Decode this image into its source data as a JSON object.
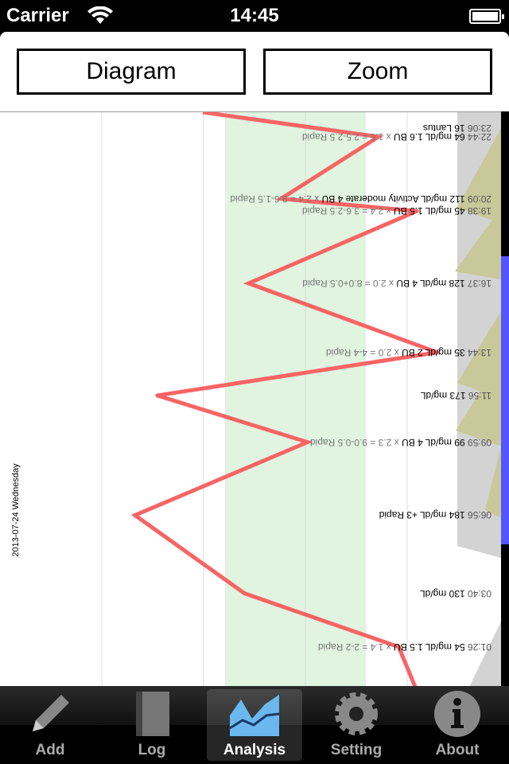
{
  "status": {
    "carrier": "Carrier",
    "time": "14:45"
  },
  "toolbar": {
    "diagram": "Diagram",
    "zoom": "Zoom"
  },
  "chart": {
    "date": "2013-07-24 Wednesday",
    "line_color": "#f86464",
    "target_band_color": "#e0f4e0",
    "entries": [
      {
        "time": "23:06",
        "main": "16 Lantus",
        "formula": ""
      },
      {
        "time": "22:44",
        "main": "64 mg/dL 1.6 BU",
        "formula": " x 1.6 = 2.5-2.5 Rapid",
        "glucose": 64
      },
      {
        "time": "20:09",
        "main": "112 mg/dL Activity moderate 4 BU",
        "formula": " x 2.4 = 9.6-1.5 Rapid",
        "glucose": 112
      },
      {
        "time": "19:38",
        "main": "45 mg/dL 1.5 BU",
        "formula": " x 2.4 = 3.6-2.5 Rapid",
        "glucose": 45
      },
      {
        "time": "16:37",
        "main": "128 mg/dL 4 BU",
        "formula": " x 2.0 = 8.0+0.5 Rapid",
        "glucose": 128
      },
      {
        "time": "13:44",
        "main": "35 mg/dL 2 BU",
        "formula": " x 2.0 = 4-4 Rapid",
        "glucose": 35
      },
      {
        "time": "11:56",
        "main": "173 mg/dL",
        "formula": "",
        "glucose": 173
      },
      {
        "time": "09:59",
        "main": "99 mg/dL 4 BU",
        "formula": " x 2.3 = 9.0-0.5 Rapid",
        "glucose": 99
      },
      {
        "time": "06:56",
        "main": "184 mg/dL +3 Rapid",
        "formula": "",
        "glucose": 184
      },
      {
        "time": "03:40",
        "main": "130 mg/dL",
        "formula": "",
        "glucose": 130
      },
      {
        "time": "01:26",
        "main": "54 mg/dL 1.5 BU",
        "formula": " x 1.4 = 2-2 Rapid",
        "glucose": 54
      }
    ]
  },
  "tabs": [
    {
      "label": "Add",
      "icon": "pencil-icon"
    },
    {
      "label": "Log",
      "icon": "notebook-icon"
    },
    {
      "label": "Analysis",
      "icon": "chart-icon",
      "selected": true
    },
    {
      "label": "Setting",
      "icon": "gear-icon"
    },
    {
      "label": "About",
      "icon": "info-icon"
    }
  ]
}
